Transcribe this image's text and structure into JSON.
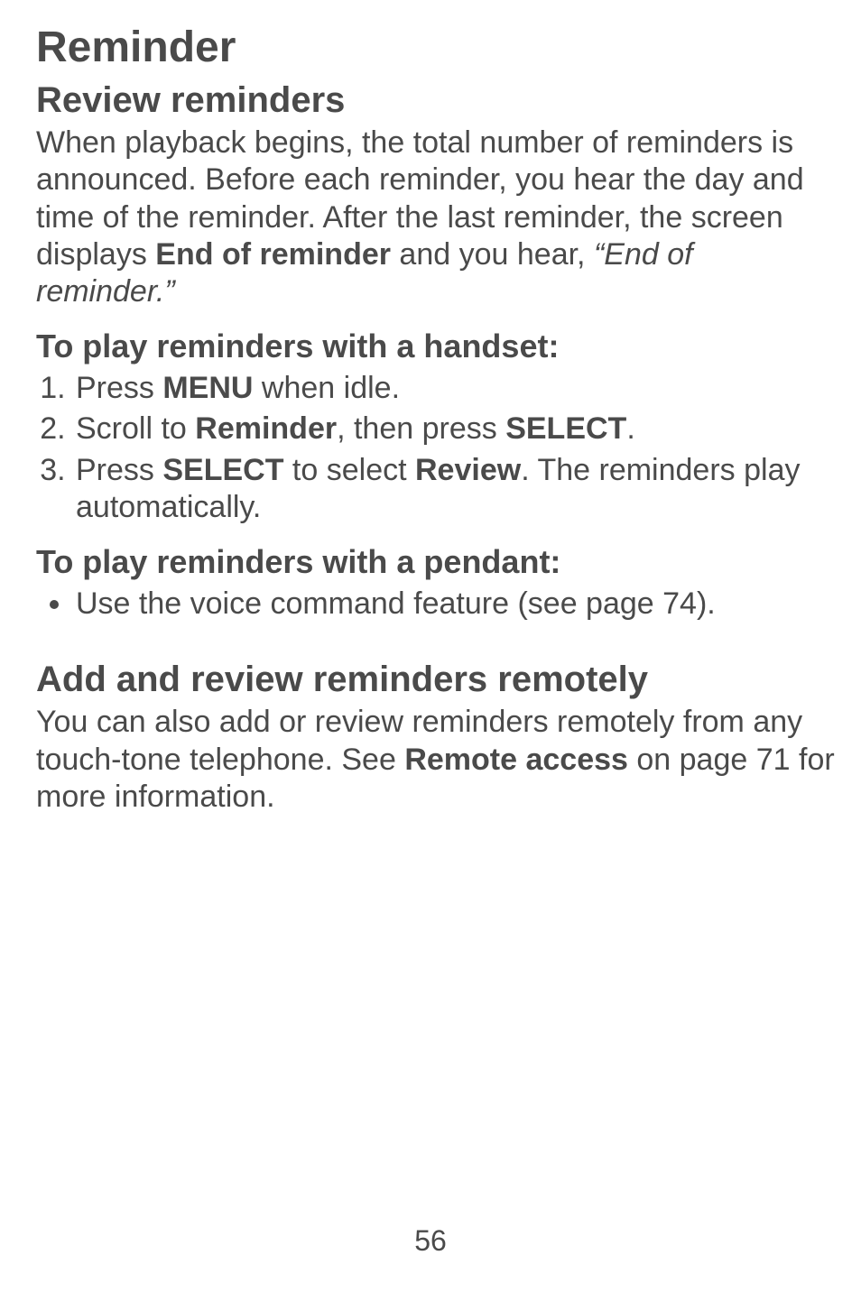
{
  "heading1": "Reminder",
  "section1": {
    "heading": "Review reminders",
    "intro_pre": "When playback begins, the total number of reminders is announced. Before each reminder, you hear the day and time of the reminder. After the last reminder, the screen displays ",
    "intro_bold": "End of reminder",
    "intro_mid": " and you hear, ",
    "intro_italic": "“End of reminder.”"
  },
  "handset": {
    "heading": "To play reminders with a handset:",
    "items": [
      {
        "pre": "Press ",
        "b1": "MENU",
        "post": " when idle."
      },
      {
        "pre": "Scroll to ",
        "b1": "Reminder",
        "mid": ", then press ",
        "b2": "SELECT",
        "post": "."
      },
      {
        "pre": "Press ",
        "b1": "SELECT",
        "mid": " to select ",
        "b2": "Review",
        "post": ". The reminders play automatically."
      }
    ]
  },
  "pendant": {
    "heading": "To play reminders with a pendant:",
    "item": "Use the voice command feature (see page 74)."
  },
  "section2": {
    "heading": "Add and review reminders remotely",
    "para_pre": "You can also add or review reminders remotely from any touch-tone telephone. See ",
    "para_bold": "Remote access",
    "para_post": " on page 71 for more information."
  },
  "page_number": "56"
}
